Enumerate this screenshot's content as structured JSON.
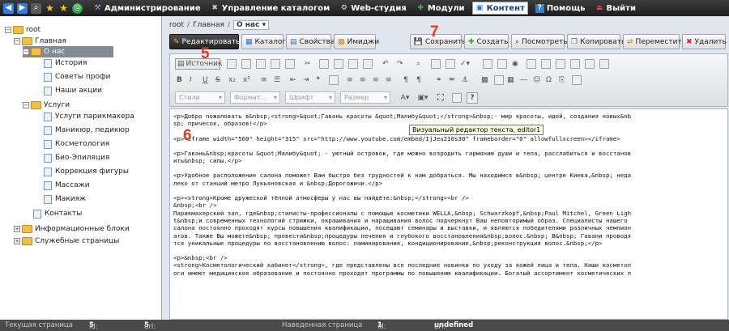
{
  "menu": {
    "items": [
      {
        "label": "Администрирование",
        "icon": "wrench-icon"
      },
      {
        "label": "Управление каталогом",
        "icon": "tools-icon"
      },
      {
        "label": "Web-студия",
        "icon": "gear-icon"
      },
      {
        "label": "Модули",
        "icon": "puzzle-icon"
      },
      {
        "label": "Контент",
        "icon": "content-icon"
      },
      {
        "label": "Помощь",
        "icon": "help-icon"
      },
      {
        "label": "Выйти",
        "icon": "exit-icon"
      }
    ]
  },
  "tree": {
    "root": "root",
    "main": "Главная",
    "about": "О нас",
    "about_children": [
      "История",
      "Советы профи",
      "Наши акции"
    ],
    "services": "Услуги",
    "services_children": [
      "Услуги парикмахера",
      "Маникюр, педикюр",
      "Косметология",
      "Био-Эпиляция",
      "Коррекция фигуры",
      "Массажи",
      "Макияж"
    ],
    "contacts": "Контакты",
    "info_blocks": "Информационные блоки",
    "service_pages": "Служебные страницы"
  },
  "breadcrumb": {
    "root": "root",
    "main": "Главная",
    "current": "О нас"
  },
  "actions": {
    "edit": "Редактировать",
    "catalog": "Каталог",
    "properties": "Свойства",
    "images": "Имиджи",
    "save": "Сохранить",
    "create": "Создать",
    "view": "Посмотреть",
    "copy": "Копировать",
    "move": "Переместить",
    "delete": "Удалить"
  },
  "editor": {
    "source_button": "Источник",
    "styles": "Стили",
    "format": "Формат...",
    "font": "Шрифт",
    "size": "Размер",
    "tooltip": "Визуальный редактор текста, editor1",
    "lines": [
      "<p>Добро пожаловать в&nbsp;<strong>&quot;Гавань красоты &quot;Малибу&quot;</strong>&nbsp;- мир красоты, идей, создания новых&nb",
      "sp; причесок, образов!</p>",
      "",
      "<p><iframe width=\"560\" height=\"315\" src=\"http://www.youtube.com/embed/IjJeu210s30\" frameborder=\"0\" allowfullscreen></iframe>",
      "",
      "<p>Гавань&nbsp;красоты &quot;Малибу&quot; - уютный островок, где можно возродить гармонию души и тела, расслабиться и восстанов",
      "ить&nbsp; силы.</p>",
      "",
      "<p>Удобное расположение салона поможет Вам быстро без трудностей к нам добраться. Мы находимся в&nbsp; центре Киева,&nbsp; неда",
      "леко от станций метро Лукьяновская и &nbsp;Дорогожичи.</p>",
      "",
      "<p><strong>Кроме дружеской тёплой атмосферы у нас вы найдёте:&nbsp;</strong><br />",
      "&nbsp;<br />",
      "Парикмахерский зал, где&nbsp;стилисты-профессионалы с помощью косметики WELLA,&nbsp; Schwarzkopf,&nbsp;Paul Mitchel, Green Ligh",
      "t&nbsp;и современных технологий стрижки, окрашивания и наращивания волос подчеркнут Ваш неповторимый образ. Специалисты нашего",
      "салона постоянно проходят курсы повышения квалификации, посещают семинары и выставки, и являются победителями различных чемпион",
      "атов. Также Вы можете&nbsp; провести&nbsp;процедуры лечения и глубокого восстановления&nbsp;волос.&nbsp; В&nbsp; Гавани проводя",
      "тся уникальные процедуры по восстановлению волос: ламинирование, кондиционирование,&nbsp;реконструкция волос.&nbsp;</p>",
      "",
      "<p>&nbsp;<br />",
      "<strong>Косметологический кабинет</strong>, где представлены все последние новинки по уходу за кожей лица и тела. Наши косметол",
      "оги имеют медицинское образование и постоянно проходят программы по повышению квалификации. Богатый ассортимент косметических л"
    ]
  },
  "annotations": {
    "n5": "5",
    "n6": "6",
    "n7": "7"
  },
  "status": {
    "current_label": "Текущая страница",
    "id_label": "id:",
    "id_value": "5",
    "url_label": "url:",
    "url_value": "5",
    "hover_label": "Наведенная страница",
    "hover_id_label": "id:",
    "hover_id_value": "1",
    "hover_url_label": "url:",
    "hover_url_value": "undefined"
  },
  "colors": {
    "accent_red": "#e53b1c",
    "menu_bg": "#2c2c2c",
    "tree_selected": "#828a92"
  }
}
